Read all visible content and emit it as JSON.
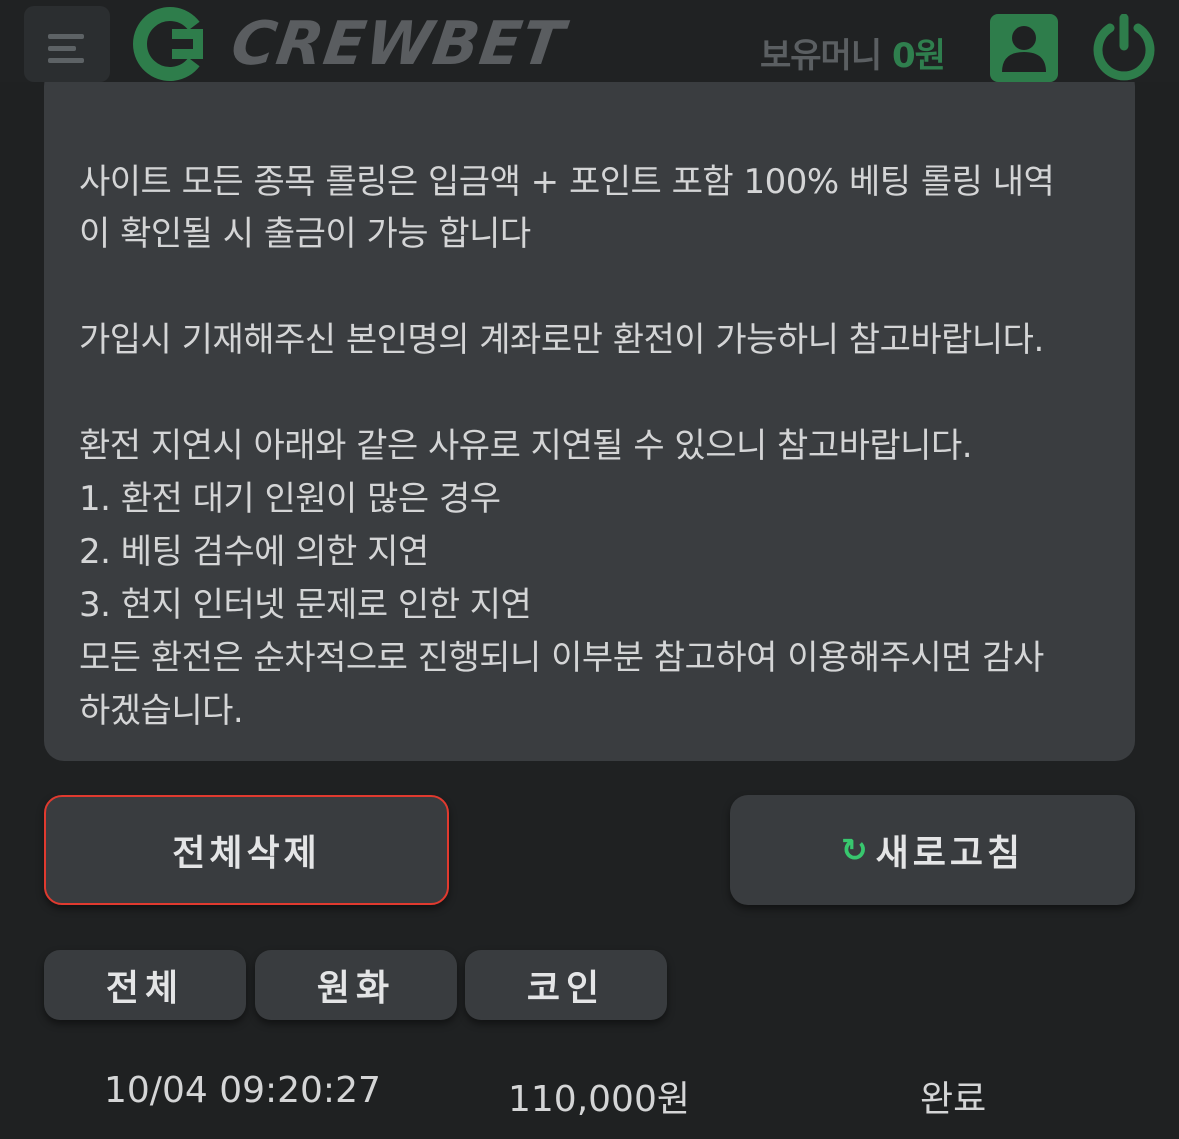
{
  "header": {
    "brand": "CREWBET",
    "balance_label": "보유머니",
    "balance_amount": "0원"
  },
  "notice": {
    "lines": [
      "사이트 모든 종목 롤링은 입금액 + 포인트 포함 100% 베팅 롤링 내역",
      "이 확인될 시 출금이 가능 합니다",
      "가입시 기재해주신 본인명의 계좌로만 환전이 가능하니 참고바랍니다.",
      "환전 지연시 아래와 같은 사유로 지연될 수 있으니 참고바랍니다.",
      "1. 환전 대기 인원이 많은 경우",
      "2. 베팅 검수에 의한 지연",
      "3. 현지 인터넷 문제로 인한 지연",
      "모든 환전은 순차적으로 진행되니 이부분 참고하여 이용해주시면 감사",
      "하겠습니다."
    ]
  },
  "actions": {
    "delete_all": "전체삭제",
    "refresh": "새로고침"
  },
  "tabs": [
    "전체",
    "원화",
    "코인"
  ],
  "history": [
    {
      "datetime": "10/04 09:20:27",
      "amount": "110,000원",
      "status": "완료"
    }
  ],
  "colors": {
    "accent_green": "#2e7d4b",
    "delete_border": "#e03a2f",
    "refresh_icon": "#38c76e"
  }
}
